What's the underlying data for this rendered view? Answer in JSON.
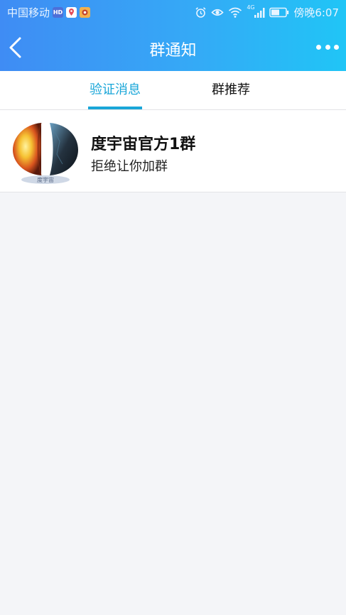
{
  "status_bar": {
    "carrier": "中国移动",
    "hd_badge": "HD",
    "network": "4G",
    "time": "傍晚6:07"
  },
  "nav": {
    "title": "群通知"
  },
  "tabs": [
    {
      "label": "验证消息",
      "active": true
    },
    {
      "label": "群推荐",
      "active": false
    }
  ],
  "notifications": [
    {
      "group_name": "度宇宙官方1群",
      "message": "拒绝让你加群",
      "avatar_caption": "度宇宙"
    }
  ],
  "colors": {
    "accent": "#19a6d8",
    "header_start": "#3f8cf4",
    "header_end": "#20c5f6",
    "background": "#f4f5f8"
  }
}
